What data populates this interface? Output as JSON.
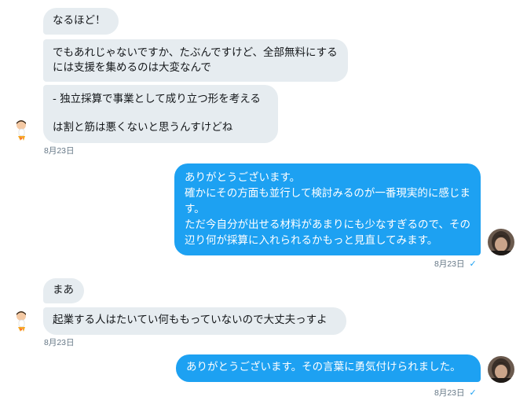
{
  "thread": {
    "group1": {
      "msg1": "なるほど！",
      "msg2": "でもあれじゃないですか、たぶんですけど、全部無料にするには支援を集めるのは大変なんで",
      "msg3": "- 独立採算で事業として成り立つ形を考える\n\nは割と筋は悪くないと思うんすけどね",
      "time": "8月23日"
    },
    "group2": {
      "msg1": "ありがとうございます。\n確かにその方面も並行して検討みるのが一番現実的に感じます。\nただ今自分が出せる材料があまりにも少なすぎるので、その辺り何が採算に入れられるかもっと見直してみます。",
      "time": "8月23日",
      "read_icon": "check-icon"
    },
    "group3": {
      "msg1": "まあ",
      "msg2": "起業する人はたいてい何ももっていないので大丈夫っすよ",
      "time": "8月23日"
    },
    "group4": {
      "msg1": "ありがとうございます。その言葉に勇気付けられました。",
      "time": "8月23日",
      "read_icon": "check-icon"
    }
  },
  "colors": {
    "incoming_bubble": "#e6ecf0",
    "outgoing_bubble": "#1da1f2",
    "timestamp": "#657786",
    "read_check": "#1da1f2"
  },
  "avatars": {
    "other_user": "rocket-character-avatar",
    "self_user": "photo-avatar"
  }
}
